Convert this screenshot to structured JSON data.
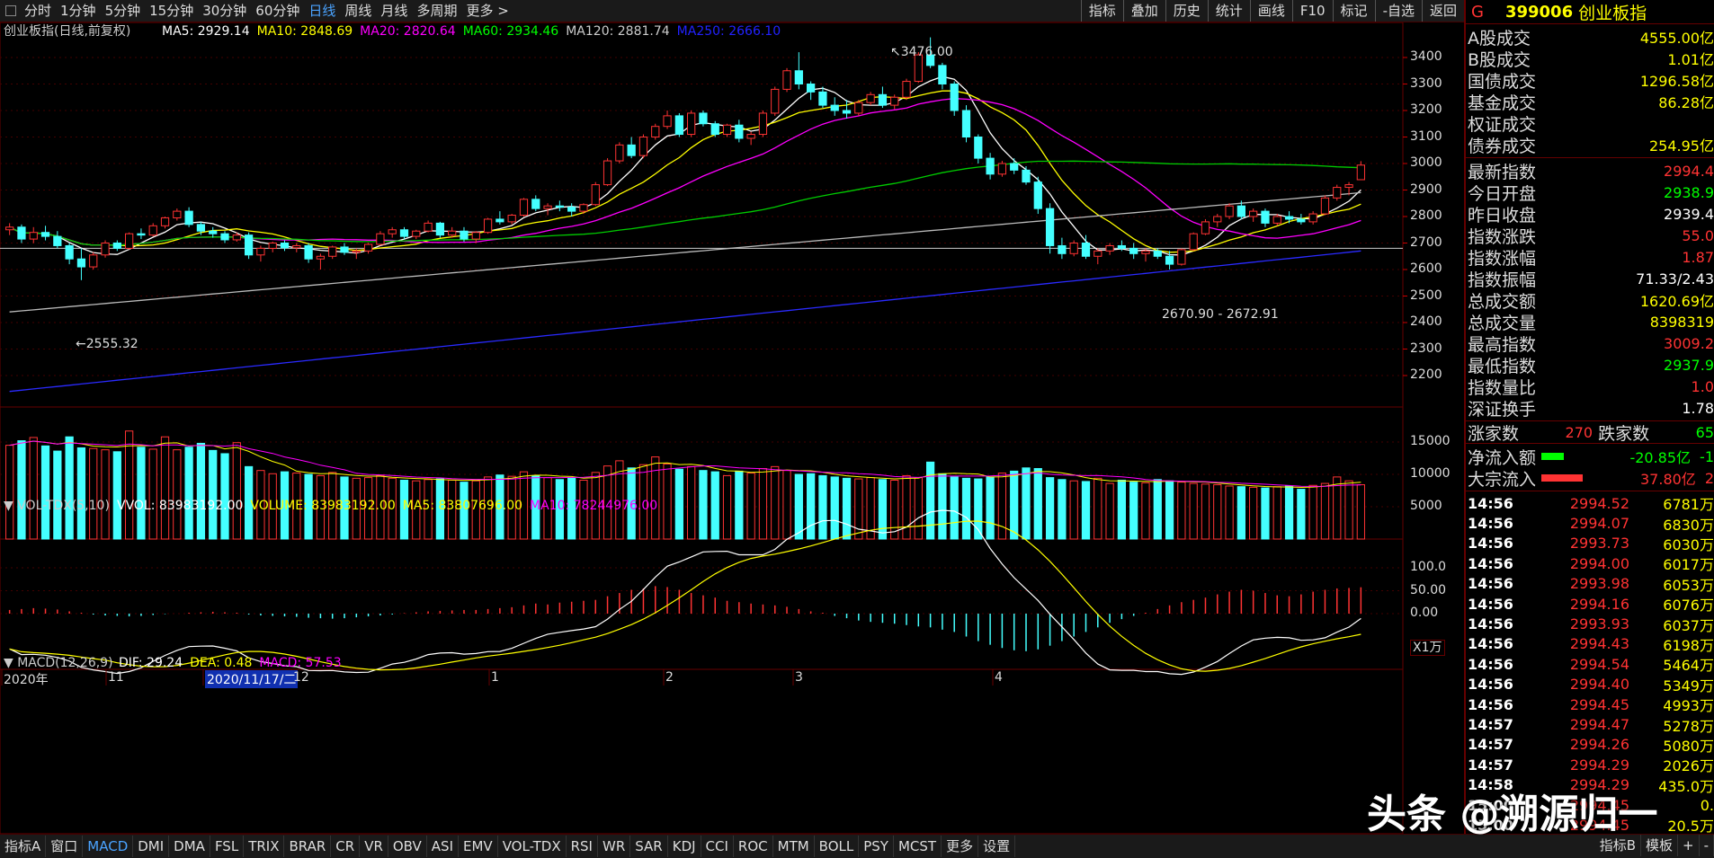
{
  "toolbar": {
    "timeframes": [
      "分时",
      "1分钟",
      "5分钟",
      "15分钟",
      "30分钟",
      "60分钟",
      "日线",
      "周线",
      "月线",
      "多周期",
      "更多 >"
    ],
    "active_timeframe": "日线",
    "right_buttons": [
      "指标",
      "叠加",
      "历史",
      "统计",
      "画线",
      "F10",
      "标记",
      "-自选",
      "返回"
    ]
  },
  "main_chart": {
    "title": "创业板指(日线,前复权)",
    "ma_legend": [
      {
        "text": "MA5: 2929.14",
        "color": "#ffffff"
      },
      {
        "text": "MA10: 2848.69",
        "color": "#ffff00"
      },
      {
        "text": "MA20: 2820.64",
        "color": "#ff00ff"
      },
      {
        "text": "MA60: 2934.46",
        "color": "#00ff00"
      },
      {
        "text": "MA120: 2881.74",
        "color": "#cccccc"
      },
      {
        "text": "MA250: 2666.10",
        "color": "#2222ff"
      }
    ],
    "high_label": "3476.00",
    "low_label": "2555.32",
    "range_label": "2670.90 - 2672.91",
    "price_ticks": [
      "3400",
      "3300",
      "3200",
      "3100",
      "3000",
      "2900",
      "2800",
      "2700",
      "2600",
      "2500",
      "2400",
      "2300",
      "2200"
    ]
  },
  "volume_chart": {
    "title": "VOL-TDX(5,10)",
    "legend": [
      {
        "text": "VVOL: 83983192.00",
        "color": "#ffffff"
      },
      {
        "text": "VOLUME: 83983192.00",
        "color": "#ffff00"
      },
      {
        "text": "MA5: 83807696.00",
        "color": "#ffff00"
      },
      {
        "text": "MA10: 78244976.00",
        "color": "#ff00ff"
      }
    ],
    "ticks": [
      "15000",
      "10000",
      "5000"
    ],
    "unit": "X1万"
  },
  "macd_chart": {
    "title": "MACD(12,26,9)",
    "legend": [
      {
        "text": "DIF: 29.24",
        "color": "#ffffff"
      },
      {
        "text": "DEA: 0.48",
        "color": "#ffff00"
      },
      {
        "text": "MACD: 57.53",
        "color": "#ff00ff"
      }
    ],
    "ticks": [
      "100.0",
      "50.00",
      "0.00"
    ]
  },
  "date_axis": [
    "2020年",
    "11",
    "2020/11/17/二",
    "12",
    "1",
    "2",
    "3",
    "4"
  ],
  "bottom_tabs": [
    "指标A",
    "窗口",
    "MACD",
    "DMI",
    "DMA",
    "FSL",
    "TRIX",
    "BRAR",
    "CR",
    "VR",
    "OBV",
    "ASI",
    "EMV",
    "VOL-TDX",
    "RSI",
    "WR",
    "SAR",
    "KDJ",
    "CCI",
    "ROC",
    "MTM",
    "BOLL",
    "PSY",
    "MCST",
    "更多",
    "设置"
  ],
  "active_bottom_tab": "MACD",
  "bottom_right": [
    "指标B",
    "模板",
    "+",
    "-"
  ],
  "side": {
    "code_prefix": "G",
    "code": "399006",
    "name": "创业板指",
    "turnover": [
      {
        "k": "A股成交",
        "v": "4555.00亿",
        "c": "#ffff00"
      },
      {
        "k": "B股成交",
        "v": "1.01亿",
        "c": "#ffff00"
      },
      {
        "k": "国债成交",
        "v": "1296.58亿",
        "c": "#ffff00"
      },
      {
        "k": "基金成交",
        "v": "86.28亿",
        "c": "#ffff00"
      },
      {
        "k": "权证成交",
        "v": "",
        "c": "#ffff00"
      },
      {
        "k": "债券成交",
        "v": "254.95亿",
        "c": "#ffff00"
      }
    ],
    "stats": [
      {
        "k": "最新指数",
        "v": "2994.4",
        "c": "#ff3333"
      },
      {
        "k": "今日开盘",
        "v": "2938.9",
        "c": "#00ff00"
      },
      {
        "k": "昨日收盘",
        "v": "2939.4",
        "c": "#ffffff"
      },
      {
        "k": "指数涨跌",
        "v": "55.0",
        "c": "#ff3333"
      },
      {
        "k": "指数涨幅",
        "v": "1.87",
        "c": "#ff3333"
      },
      {
        "k": "指数振幅",
        "v": "71.33/2.43",
        "c": "#ffffff"
      },
      {
        "k": "总成交额",
        "v": "1620.69亿",
        "c": "#ffff00"
      },
      {
        "k": "总成交量",
        "v": "8398319",
        "c": "#ffff00"
      },
      {
        "k": "最高指数",
        "v": "3009.2",
        "c": "#ff3333"
      },
      {
        "k": "最低指数",
        "v": "2937.9",
        "c": "#00ff00"
      },
      {
        "k": "指数量比",
        "v": "1.0",
        "c": "#ff3333"
      },
      {
        "k": "深证换手",
        "v": "1.78",
        "c": "#ffffff"
      }
    ],
    "updown": {
      "up_label": "涨家数",
      "up": "270",
      "down_label": "跌家数",
      "down": "65"
    },
    "flows": [
      {
        "k": "净流入额",
        "v": "-20.85亿",
        "v2": "-1",
        "bar": "#00ff00",
        "c": "#00ff00",
        "fill": 0.35
      },
      {
        "k": "大宗流入",
        "v": "37.80亿",
        "v2": "2",
        "bar": "#ff3333",
        "c": "#ff3333",
        "fill": 0.65
      }
    ],
    "ticks": [
      {
        "t": "14:56",
        "p": "2994.52",
        "v": "6781万"
      },
      {
        "t": "14:56",
        "p": "2994.07",
        "v": "6830万"
      },
      {
        "t": "14:56",
        "p": "2993.73",
        "v": "6030万"
      },
      {
        "t": "14:56",
        "p": "2994.00",
        "v": "6017万"
      },
      {
        "t": "14:56",
        "p": "2993.98",
        "v": "6053万"
      },
      {
        "t": "14:56",
        "p": "2994.16",
        "v": "6076万"
      },
      {
        "t": "14:56",
        "p": "2993.93",
        "v": "6037万"
      },
      {
        "t": "14:56",
        "p": "2994.43",
        "v": "6198万"
      },
      {
        "t": "14:56",
        "p": "2994.54",
        "v": "5464万"
      },
      {
        "t": "14:56",
        "p": "2994.40",
        "v": "5349万"
      },
      {
        "t": "14:56",
        "p": "2994.45",
        "v": "4993万"
      },
      {
        "t": "14:57",
        "p": "2994.47",
        "v": "5278万"
      },
      {
        "t": "14:57",
        "p": "2994.26",
        "v": "5080万"
      },
      {
        "t": "14:57",
        "p": "2994.29",
        "v": "2026万"
      },
      {
        "t": "14:58",
        "p": "2994.29",
        "v": "435.0万"
      },
      {
        "t": "15:00",
        "p": "2994.45",
        "v": "0."
      },
      {
        "t": "15:00",
        "p": "2994.45",
        "v": "20.5万"
      }
    ]
  },
  "watermark": "头条 @溯源归一",
  "chart_data": {
    "type": "candlestick",
    "title": "创业板指(日线,前复权)",
    "ylim": [
      2130,
      3560
    ],
    "ohlc": [
      [
        2750,
        2775,
        2730,
        2760
      ],
      [
        2760,
        2770,
        2700,
        2715
      ],
      [
        2715,
        2760,
        2700,
        2740
      ],
      [
        2740,
        2765,
        2710,
        2725
      ],
      [
        2725,
        2745,
        2680,
        2690
      ],
      [
        2690,
        2700,
        2620,
        2640
      ],
      [
        2640,
        2680,
        2560,
        2610
      ],
      [
        2610,
        2665,
        2600,
        2655
      ],
      [
        2655,
        2710,
        2645,
        2700
      ],
      [
        2700,
        2710,
        2670,
        2680
      ],
      [
        2680,
        2740,
        2675,
        2735
      ],
      [
        2735,
        2755,
        2715,
        2730
      ],
      [
        2730,
        2775,
        2725,
        2765
      ],
      [
        2765,
        2800,
        2755,
        2795
      ],
      [
        2795,
        2830,
        2785,
        2820
      ],
      [
        2820,
        2835,
        2760,
        2770
      ],
      [
        2770,
        2780,
        2730,
        2745
      ],
      [
        2745,
        2760,
        2720,
        2735
      ],
      [
        2735,
        2745,
        2700,
        2712
      ],
      [
        2712,
        2740,
        2705,
        2730
      ],
      [
        2730,
        2740,
        2640,
        2655
      ],
      [
        2655,
        2690,
        2630,
        2680
      ],
      [
        2680,
        2705,
        2665,
        2700
      ],
      [
        2700,
        2710,
        2670,
        2682
      ],
      [
        2682,
        2700,
        2665,
        2690
      ],
      [
        2690,
        2700,
        2625,
        2640
      ],
      [
        2640,
        2660,
        2600,
        2650
      ],
      [
        2650,
        2690,
        2640,
        2685
      ],
      [
        2685,
        2700,
        2655,
        2665
      ],
      [
        2665,
        2680,
        2640,
        2670
      ],
      [
        2670,
        2700,
        2660,
        2695
      ],
      [
        2695,
        2745,
        2690,
        2735
      ],
      [
        2735,
        2760,
        2720,
        2750
      ],
      [
        2750,
        2760,
        2715,
        2725
      ],
      [
        2725,
        2750,
        2715,
        2745
      ],
      [
        2745,
        2785,
        2740,
        2775
      ],
      [
        2775,
        2780,
        2720,
        2730
      ],
      [
        2730,
        2760,
        2720,
        2745
      ],
      [
        2745,
        2760,
        2705,
        2715
      ],
      [
        2715,
        2745,
        2700,
        2740
      ],
      [
        2740,
        2795,
        2735,
        2790
      ],
      [
        2790,
        2820,
        2770,
        2780
      ],
      [
        2780,
        2810,
        2770,
        2805
      ],
      [
        2805,
        2870,
        2800,
        2865
      ],
      [
        2865,
        2880,
        2820,
        2830
      ],
      [
        2830,
        2850,
        2805,
        2840
      ],
      [
        2840,
        2860,
        2820,
        2835
      ],
      [
        2835,
        2850,
        2800,
        2820
      ],
      [
        2820,
        2850,
        2810,
        2845
      ],
      [
        2845,
        2930,
        2840,
        2920
      ],
      [
        2920,
        3020,
        2915,
        3010
      ],
      [
        3010,
        3080,
        3000,
        3070
      ],
      [
        3070,
        3100,
        3020,
        3030
      ],
      [
        3030,
        3110,
        3020,
        3100
      ],
      [
        3100,
        3150,
        3090,
        3140
      ],
      [
        3140,
        3200,
        3130,
        3180
      ],
      [
        3180,
        3190,
        3100,
        3110
      ],
      [
        3110,
        3200,
        3100,
        3190
      ],
      [
        3190,
        3200,
        3140,
        3150
      ],
      [
        3150,
        3160,
        3100,
        3110
      ],
      [
        3110,
        3150,
        3100,
        3145
      ],
      [
        3145,
        3165,
        3080,
        3095
      ],
      [
        3095,
        3120,
        3070,
        3110
      ],
      [
        3110,
        3200,
        3100,
        3190
      ],
      [
        3190,
        3290,
        3180,
        3280
      ],
      [
        3280,
        3360,
        3270,
        3350
      ],
      [
        3350,
        3420,
        3280,
        3300
      ],
      [
        3300,
        3310,
        3240,
        3270
      ],
      [
        3270,
        3290,
        3210,
        3220
      ],
      [
        3220,
        3250,
        3180,
        3200
      ],
      [
        3200,
        3240,
        3170,
        3190
      ],
      [
        3190,
        3240,
        3180,
        3230
      ],
      [
        3230,
        3270,
        3220,
        3260
      ],
      [
        3260,
        3290,
        3210,
        3220
      ],
      [
        3220,
        3260,
        3205,
        3250
      ],
      [
        3250,
        3320,
        3240,
        3310
      ],
      [
        3310,
        3420,
        3305,
        3410
      ],
      [
        3410,
        3476,
        3360,
        3370
      ],
      [
        3370,
        3380,
        3280,
        3300
      ],
      [
        3300,
        3310,
        3180,
        3200
      ],
      [
        3200,
        3220,
        3080,
        3100
      ],
      [
        3100,
        3110,
        3000,
        3020
      ],
      [
        3020,
        3040,
        2940,
        2960
      ],
      [
        2960,
        3010,
        2950,
        3000
      ],
      [
        3000,
        3020,
        2960,
        2975
      ],
      [
        2975,
        2990,
        2920,
        2930
      ],
      [
        2930,
        2950,
        2810,
        2830
      ],
      [
        2830,
        2850,
        2660,
        2690
      ],
      [
        2690,
        2720,
        2640,
        2660
      ],
      [
        2660,
        2710,
        2650,
        2700
      ],
      [
        2700,
        2730,
        2640,
        2650
      ],
      [
        2650,
        2680,
        2620,
        2670
      ],
      [
        2670,
        2700,
        2655,
        2690
      ],
      [
        2690,
        2710,
        2670,
        2680
      ],
      [
        2680,
        2700,
        2640,
        2660
      ],
      [
        2660,
        2680,
        2630,
        2670
      ],
      [
        2670,
        2680,
        2640,
        2650
      ],
      [
        2650,
        2670,
        2600,
        2620
      ],
      [
        2620,
        2680,
        2615,
        2675
      ],
      [
        2675,
        2740,
        2670,
        2735
      ],
      [
        2735,
        2790,
        2730,
        2780
      ],
      [
        2780,
        2810,
        2760,
        2800
      ],
      [
        2800,
        2850,
        2790,
        2840
      ],
      [
        2840,
        2860,
        2790,
        2800
      ],
      [
        2800,
        2830,
        2780,
        2820
      ],
      [
        2820,
        2830,
        2760,
        2775
      ],
      [
        2775,
        2810,
        2765,
        2800
      ],
      [
        2800,
        2820,
        2775,
        2790
      ],
      [
        2790,
        2810,
        2770,
        2780
      ],
      [
        2780,
        2820,
        2770,
        2810
      ],
      [
        2810,
        2880,
        2805,
        2870
      ],
      [
        2870,
        2920,
        2860,
        2910
      ],
      [
        2910,
        2930,
        2880,
        2920
      ],
      [
        2939,
        3009,
        2938,
        2994
      ]
    ],
    "volume": [
      14500,
      15200,
      15700,
      14400,
      13600,
      15800,
      14100,
      14000,
      13800,
      13500,
      16700,
      14200,
      13900,
      15800,
      13800,
      14200,
      14800,
      13700,
      13200,
      14900,
      11200,
      10600,
      10100,
      10400,
      10200,
      10000,
      9800,
      10300,
      9600,
      9400,
      9500,
      9800,
      9400,
      9100,
      9000,
      9200,
      9300,
      9100,
      8800,
      9000,
      9600,
      9900,
      9700,
      10400,
      9800,
      9500,
      9200,
      9400,
      9100,
      10300,
      11300,
      12100,
      11000,
      11500,
      12700,
      11600,
      10800,
      11200,
      10600,
      10400,
      9800,
      10500,
      10200,
      10900,
      11200,
      10600,
      10000,
      10100,
      9800,
      9600,
      9400,
      9300,
      9500,
      9200,
      9100,
      9800,
      9500,
      11900,
      10100,
      9600,
      9400,
      9300,
      9600,
      10200,
      10500,
      11000,
      10900,
      9500,
      9200,
      9000,
      8900,
      9400,
      8600,
      9100,
      8800,
      8700,
      9200,
      9000,
      8800,
      8600,
      8500,
      8400,
      8200,
      8100,
      8000,
      7900,
      8100,
      8200,
      7700,
      8300,
      8600,
      9600,
      9000,
      8398
    ],
    "macd_hist": [
      8,
      10,
      12,
      11,
      9,
      5,
      2,
      -2,
      -4,
      -5,
      -6,
      -5,
      -3,
      -1,
      0,
      2,
      3,
      4,
      3,
      2,
      -2,
      -4,
      -5,
      -6,
      -7,
      -9,
      -10,
      -11,
      -10,
      -8,
      -6,
      -4,
      -2,
      1,
      3,
      5,
      6,
      7,
      8,
      8,
      10,
      12,
      14,
      18,
      22,
      20,
      24,
      26,
      28,
      30,
      38,
      45,
      52,
      55,
      60,
      58,
      52,
      45,
      40,
      35,
      28,
      25,
      22,
      20,
      18,
      15,
      10,
      5,
      2,
      -5,
      -10,
      -15,
      -18,
      -20,
      -22,
      -25,
      -28,
      -30,
      -35,
      -40,
      -50,
      -60,
      -68,
      -75,
      -80,
      -82,
      -78,
      -70,
      -60,
      -50,
      -40,
      -30,
      -20,
      -12,
      -5,
      2,
      10,
      18,
      25,
      30,
      35,
      42,
      48,
      52,
      50,
      45,
      40,
      38,
      42,
      48,
      52,
      55,
      56,
      57.53
    ]
  }
}
